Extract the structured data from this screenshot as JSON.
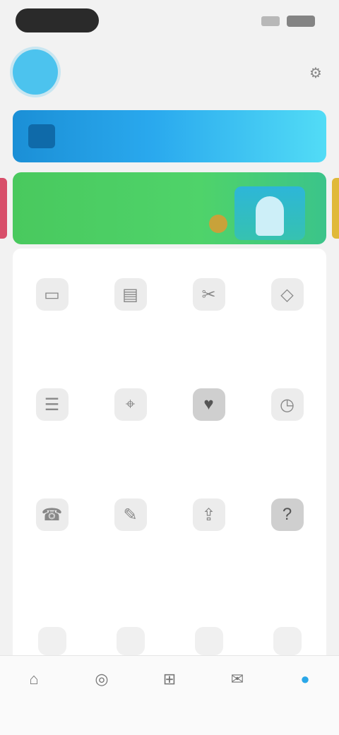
{
  "header": {
    "user_name": "",
    "user_sub": "",
    "action_icon": "settings-icon"
  },
  "member_banner": {
    "text": "",
    "icon": "vip-icon",
    "gradient": [
      "#1b8fd6",
      "#52dcf6"
    ]
  },
  "promo": {
    "title": "",
    "subtitle": "",
    "color": "#4fd36a"
  },
  "grid": {
    "rows": [
      [
        {
          "icon": "wallet-icon",
          "label": ""
        },
        {
          "icon": "card-icon",
          "label": ""
        },
        {
          "icon": "coupon-icon",
          "label": ""
        },
        {
          "icon": "points-icon",
          "label": ""
        }
      ],
      [
        {
          "icon": "order-icon",
          "label": ""
        },
        {
          "icon": "location-icon",
          "label": ""
        },
        {
          "icon": "favorite-icon",
          "label": ""
        },
        {
          "icon": "history-icon",
          "label": ""
        }
      ],
      [
        {
          "icon": "service-icon",
          "label": ""
        },
        {
          "icon": "feedback-icon",
          "label": ""
        },
        {
          "icon": "share-icon",
          "label": ""
        },
        {
          "icon": "help-icon",
          "label": ""
        }
      ]
    ]
  },
  "tabbar": {
    "items": [
      {
        "icon": "home-icon",
        "label": ""
      },
      {
        "icon": "discover-icon",
        "label": ""
      },
      {
        "icon": "cart-icon",
        "label": ""
      },
      {
        "icon": "message-icon",
        "label": ""
      },
      {
        "icon": "profile-icon",
        "label": "",
        "active": true
      }
    ],
    "accent": "#2aa7e8"
  }
}
